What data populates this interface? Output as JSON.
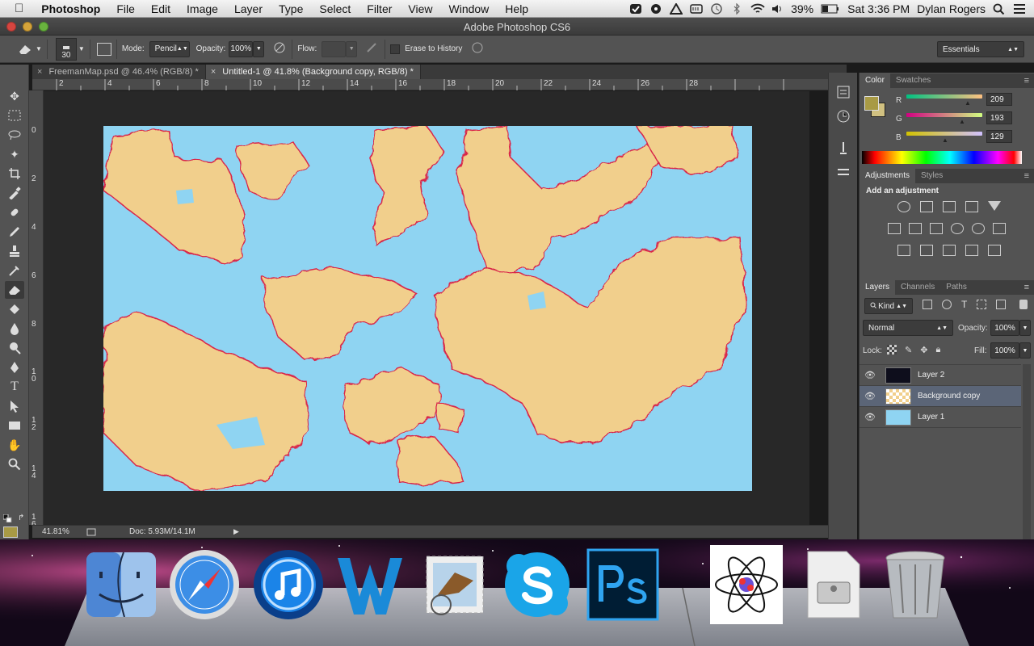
{
  "menubar": {
    "app_name": "Photoshop",
    "items": [
      "File",
      "Edit",
      "Image",
      "Layer",
      "Type",
      "Select",
      "Filter",
      "View",
      "Window",
      "Help"
    ],
    "battery": "39%",
    "clock": "Sat 3:36 PM",
    "user": "Dylan Rogers"
  },
  "window": {
    "title": "Adobe Photoshop CS6"
  },
  "options": {
    "brush_size": "30",
    "mode_label": "Mode:",
    "mode_value": "Pencil",
    "opacity_label": "Opacity:",
    "opacity_value": "100%",
    "flow_label": "Flow:",
    "erase_history": "Erase to History",
    "workspace": "Essentials"
  },
  "tabs": [
    {
      "label": "FreemanMap.psd @ 46.4% (RGB/8) *"
    },
    {
      "label": "Untitled-1 @ 41.8% (Background copy, RGB/8) *"
    }
  ],
  "ruler": {
    "top": [
      "2",
      "4",
      "6",
      "8",
      "10",
      "12",
      "14",
      "16",
      "18",
      "20",
      "22",
      "24",
      "26",
      "28"
    ],
    "left": [
      "0",
      "2",
      "4",
      "6",
      "8",
      "10",
      "12",
      "14",
      "16"
    ]
  },
  "status": {
    "zoom": "41.81%",
    "doc": "Doc: 5.93M/14.1M"
  },
  "color_panel": {
    "tabs": [
      "Color",
      "Swatches"
    ],
    "channels": [
      {
        "label": "R",
        "value": "209"
      },
      {
        "label": "G",
        "value": "193"
      },
      {
        "label": "B",
        "value": "129"
      }
    ],
    "foreground": "#a89a45",
    "background": "#d1c181"
  },
  "adjust_panel": {
    "tabs": [
      "Adjustments",
      "Styles"
    ],
    "heading": "Add an adjustment"
  },
  "layers_panel": {
    "tabs": [
      "Layers",
      "Channels",
      "Paths"
    ],
    "kind": "Kind",
    "blend": "Normal",
    "opacity_label": "Opacity:",
    "opacity_value": "100%",
    "lock_label": "Lock:",
    "fill_label": "Fill:",
    "fill_value": "100%",
    "layers": [
      {
        "name": "Layer 2"
      },
      {
        "name": "Background copy"
      },
      {
        "name": "Layer 1"
      }
    ]
  }
}
